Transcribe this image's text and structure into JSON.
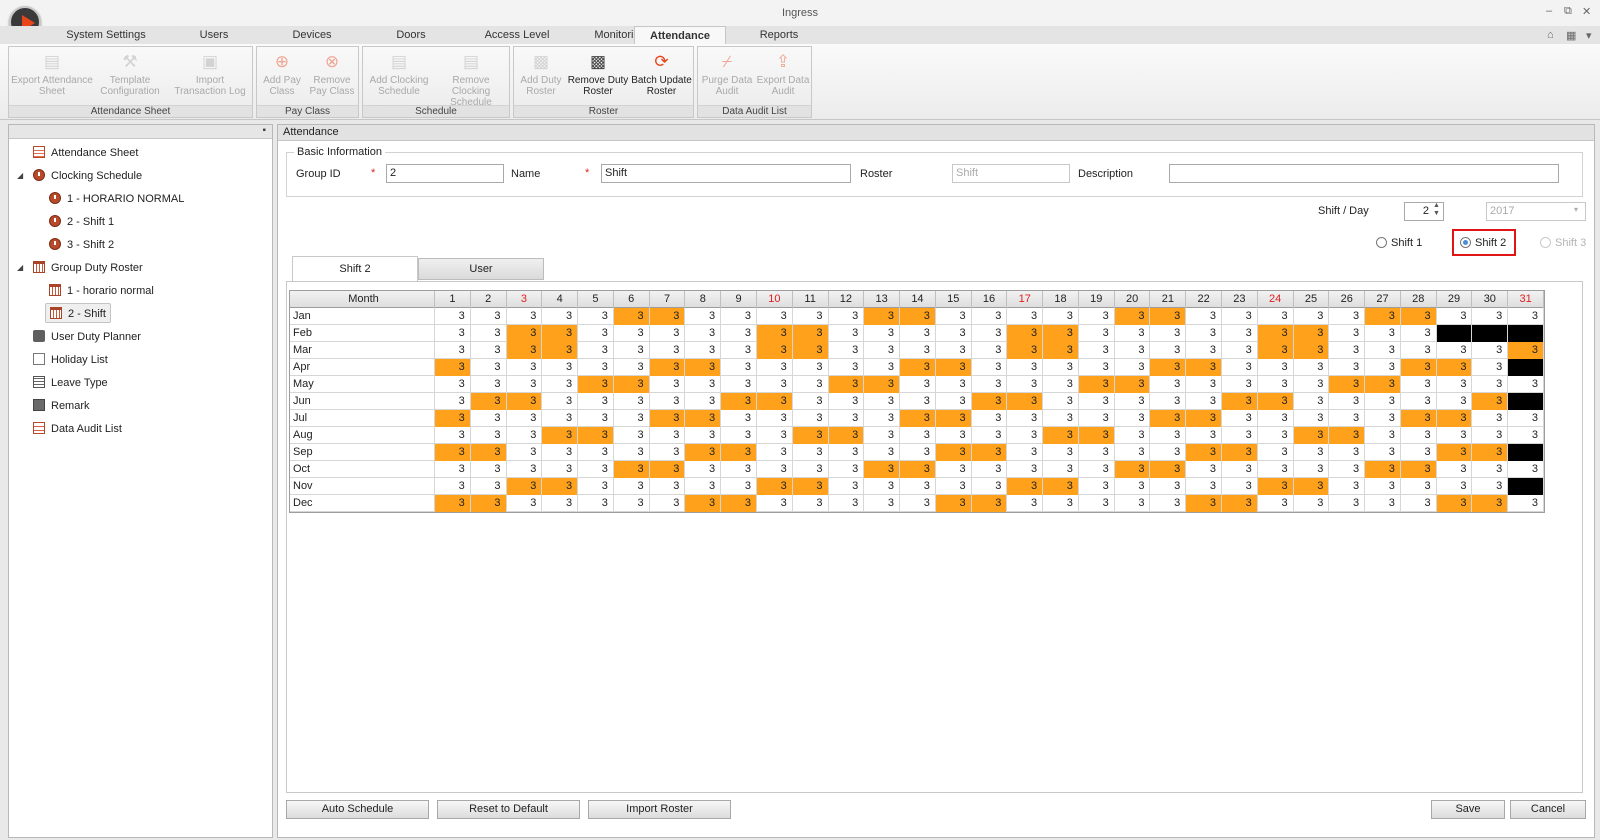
{
  "window": {
    "title": "Ingress"
  },
  "tabs": [
    {
      "label": "System Settings"
    },
    {
      "label": "Users"
    },
    {
      "label": "Devices"
    },
    {
      "label": "Doors"
    },
    {
      "label": "Access Level"
    },
    {
      "label": "Monitoring"
    },
    {
      "label": "Attendance",
      "active": true
    },
    {
      "label": "Reports"
    }
  ],
  "ribbon": {
    "groups": [
      {
        "label": "Attendance Sheet",
        "buttons": [
          {
            "label": "Export Attendance Sheet",
            "icon": "export-sheet-icon",
            "enabled": false
          },
          {
            "label": "Template Configuration",
            "icon": "template-config-icon",
            "enabled": false
          },
          {
            "label": "Import Transaction Log",
            "icon": "import-log-icon",
            "enabled": false
          }
        ]
      },
      {
        "label": "Pay Class",
        "buttons": [
          {
            "label": "Add Pay Class",
            "icon": "add-icon",
            "enabled": false
          },
          {
            "label": "Remove Pay Class",
            "icon": "remove-icon",
            "enabled": false
          }
        ]
      },
      {
        "label": "Schedule",
        "buttons": [
          {
            "label": "Add Clocking Schedule",
            "icon": "add-schedule-icon",
            "enabled": false
          },
          {
            "label": "Remove Clocking Schedule",
            "icon": "remove-schedule-icon",
            "enabled": false
          }
        ]
      },
      {
        "label": "Roster",
        "buttons": [
          {
            "label": "Add Duty Roster",
            "icon": "add-roster-icon",
            "enabled": false
          },
          {
            "label": "Remove Duty Roster",
            "icon": "remove-roster-icon",
            "enabled": true
          },
          {
            "label": "Batch Update Roster",
            "icon": "refresh-icon",
            "enabled": true
          }
        ]
      },
      {
        "label": "Data Audit List",
        "buttons": [
          {
            "label": "Purge Data Audit",
            "icon": "broom-icon",
            "enabled": false
          },
          {
            "label": "Export Data Audit",
            "icon": "export-icon",
            "enabled": false
          }
        ]
      }
    ]
  },
  "tree": [
    {
      "label": "Attendance Sheet",
      "icon": "sheet"
    },
    {
      "label": "Clocking Schedule",
      "icon": "clock",
      "expanded": true
    },
    {
      "label": "1 - HORARIO NORMAL",
      "icon": "clock"
    },
    {
      "label": "2 - Shift 1",
      "icon": "clock"
    },
    {
      "label": "3 - Shift 2",
      "icon": "clock"
    },
    {
      "label": "Group Duty Roster",
      "icon": "roster",
      "expanded": true
    },
    {
      "label": "1 - horario normal",
      "icon": "roster"
    },
    {
      "label": "2 - Shift",
      "icon": "roster",
      "selected": true
    },
    {
      "label": "User Duty Planner",
      "icon": "case"
    },
    {
      "label": "Holiday List",
      "icon": "gift"
    },
    {
      "label": "Leave Type",
      "icon": "grid"
    },
    {
      "label": "Remark",
      "icon": "remark"
    },
    {
      "label": "Data Audit List",
      "icon": "audit"
    }
  ],
  "main": {
    "title": "Attendance",
    "basic_info": {
      "legend": "Basic Information",
      "group_id_label": "Group ID",
      "group_id_value": "2",
      "name_label": "Name",
      "name_value": "Shift",
      "roster_label": "Roster",
      "roster_placeholder": "Shift",
      "description_label": "Description",
      "description_value": "",
      "required_mark": "*"
    },
    "shift_per_day_label": "Shift / Day",
    "shift_per_day_value": "2",
    "year_value": "2017",
    "shift_radios": [
      {
        "label": "Shift 1",
        "checked": false,
        "enabled": true
      },
      {
        "label": "Shift 2",
        "checked": true,
        "enabled": true
      },
      {
        "label": "Shift 3",
        "checked": false,
        "enabled": false
      }
    ],
    "subtabs": [
      {
        "label": "Shift 2"
      },
      {
        "label": "User"
      }
    ],
    "grid": {
      "month_header": "Month",
      "day_headers": [
        "1",
        "2",
        "3",
        "4",
        "5",
        "6",
        "7",
        "8",
        "9",
        "10",
        "11",
        "12",
        "13",
        "14",
        "15",
        "16",
        "17",
        "18",
        "19",
        "20",
        "21",
        "22",
        "23",
        "24",
        "25",
        "26",
        "27",
        "28",
        "29",
        "30",
        "31"
      ],
      "red_days": [
        3,
        10,
        17,
        24,
        31
      ],
      "cell_value": "3",
      "rows": [
        {
          "month": "Jan",
          "orange": [
            6,
            7,
            13,
            14,
            20,
            21,
            27,
            28
          ],
          "black": []
        },
        {
          "month": "Feb",
          "orange": [
            3,
            4,
            10,
            11,
            17,
            18,
            24,
            25
          ],
          "black": [
            29,
            30,
            31
          ]
        },
        {
          "month": "Mar",
          "orange": [
            3,
            4,
            10,
            11,
            17,
            18,
            24,
            25,
            31
          ],
          "black": []
        },
        {
          "month": "Apr",
          "orange": [
            1,
            7,
            8,
            14,
            15,
            21,
            22,
            28,
            29
          ],
          "black": [
            31
          ]
        },
        {
          "month": "May",
          "orange": [
            5,
            6,
            12,
            13,
            19,
            20,
            26,
            27
          ],
          "black": []
        },
        {
          "month": "Jun",
          "orange": [
            2,
            3,
            9,
            10,
            16,
            17,
            23,
            24,
            30
          ],
          "black": [
            31
          ]
        },
        {
          "month": "Jul",
          "orange": [
            1,
            7,
            8,
            14,
            15,
            21,
            22,
            28,
            29
          ],
          "black": []
        },
        {
          "month": "Aug",
          "orange": [
            4,
            5,
            11,
            12,
            18,
            19,
            25,
            26
          ],
          "black": []
        },
        {
          "month": "Sep",
          "orange": [
            1,
            2,
            8,
            9,
            15,
            16,
            22,
            23,
            29,
            30
          ],
          "black": [
            31
          ]
        },
        {
          "month": "Oct",
          "orange": [
            6,
            7,
            13,
            14,
            20,
            21,
            27,
            28
          ],
          "black": []
        },
        {
          "month": "Nov",
          "orange": [
            3,
            4,
            10,
            11,
            17,
            18,
            24,
            25
          ],
          "black": [
            31
          ]
        },
        {
          "month": "Dec",
          "orange": [
            1,
            2,
            8,
            9,
            15,
            16,
            22,
            23,
            29,
            30
          ],
          "black": []
        }
      ]
    },
    "buttons": {
      "auto_schedule": "Auto Schedule",
      "reset_default": "Reset to Default",
      "import_roster": "Import Roster",
      "save": "Save",
      "cancel": "Cancel"
    }
  },
  "colors": {
    "weekend": "#ffa11b",
    "invalid_day": "#000000",
    "highlight": "#e01515"
  }
}
